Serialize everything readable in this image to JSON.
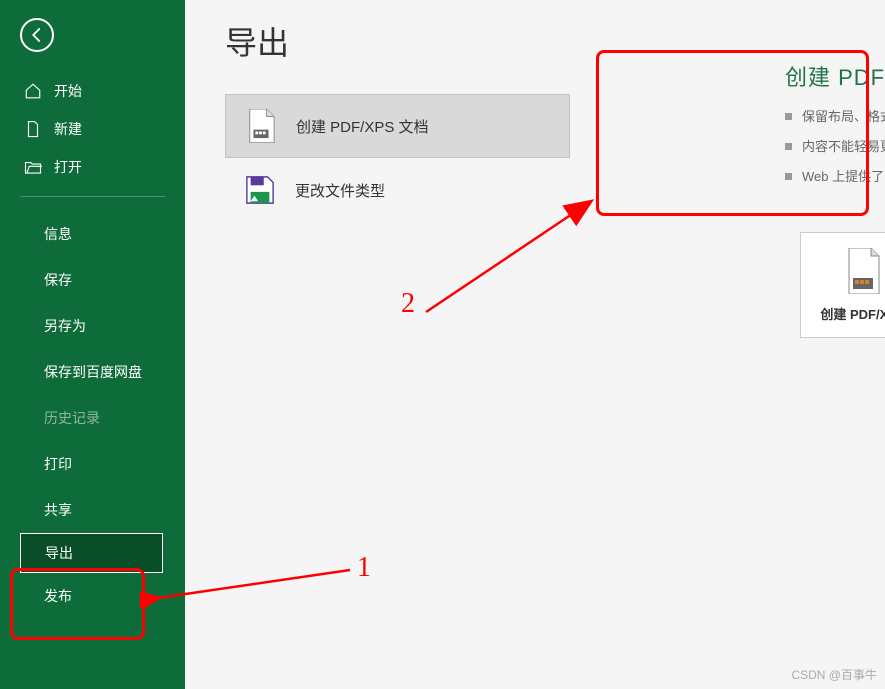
{
  "sidebar": {
    "primary": [
      {
        "label": "开始",
        "icon": "home-icon"
      },
      {
        "label": "新建",
        "icon": "new-file-icon"
      },
      {
        "label": "打开",
        "icon": "folder-open-icon"
      }
    ],
    "secondary": [
      {
        "label": "信息",
        "disabled": false
      },
      {
        "label": "保存",
        "disabled": false
      },
      {
        "label": "另存为",
        "disabled": false
      },
      {
        "label": "保存到百度网盘",
        "disabled": false
      },
      {
        "label": "历史记录",
        "disabled": true
      },
      {
        "label": "打印",
        "disabled": false
      },
      {
        "label": "共享",
        "disabled": false
      },
      {
        "label": "导出",
        "disabled": false,
        "selected": true
      },
      {
        "label": "发布",
        "disabled": false
      }
    ]
  },
  "main": {
    "title": "导出",
    "options": [
      {
        "label": "创建 PDF/XPS 文档",
        "icon": "pdf-icon",
        "selected": true
      },
      {
        "label": "更改文件类型",
        "icon": "save-as-icon",
        "selected": false
      }
    ]
  },
  "detail": {
    "title": "创建 PDF/XPS 文档",
    "bullets": [
      "保留布局、格式、字体和图像",
      "内容不能轻易更改",
      "Web 上提供了免费查看器"
    ],
    "action_label": "创建 PDF/XPS"
  },
  "annotations": {
    "label1": "1",
    "label2": "2"
  },
  "watermark": "CSDN @百事牛"
}
